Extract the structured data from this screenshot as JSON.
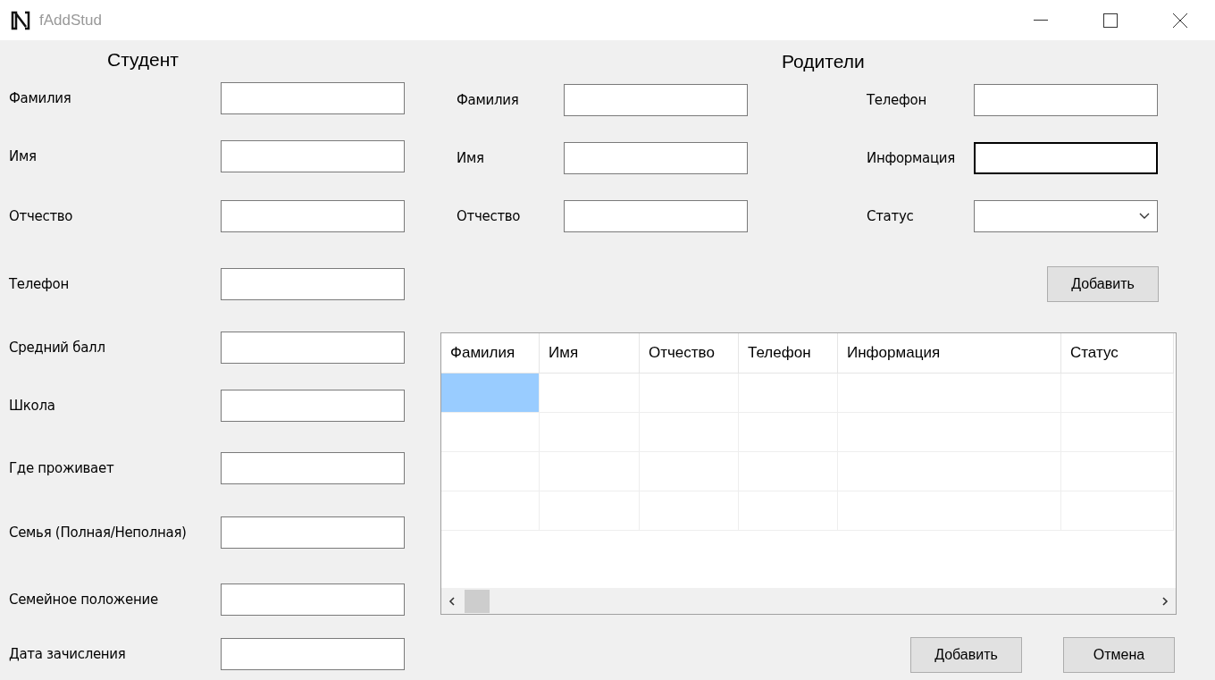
{
  "window": {
    "title": "fAddStud"
  },
  "student": {
    "heading": "Студент",
    "fields": [
      {
        "label": "Фамилия"
      },
      {
        "label": "Имя"
      },
      {
        "label": "Отчество"
      },
      {
        "label": "Телефон"
      },
      {
        "label": "Средний балл"
      },
      {
        "label": "Школа"
      },
      {
        "label": "Где проживает"
      },
      {
        "label": "Семья (Полная/Неполная)"
      },
      {
        "label": "Семейное положение"
      },
      {
        "label": "Дата зачисления"
      }
    ]
  },
  "parents": {
    "heading": "Родители",
    "fields": [
      {
        "label": "Фамилия",
        "kind": "text",
        "focused": false
      },
      {
        "label": "Телефон",
        "kind": "text",
        "focused": false
      },
      {
        "label": "Имя",
        "kind": "text",
        "focused": false
      },
      {
        "label": "Информация",
        "kind": "text",
        "focused": true
      },
      {
        "label": "Отчество",
        "kind": "text",
        "focused": false
      },
      {
        "label": "Статус",
        "kind": "dropdown",
        "focused": false
      }
    ],
    "add_button": "Добавить",
    "table": {
      "columns": [
        "Фамилия",
        "Имя",
        "Отчество",
        "Телефон",
        "Информация",
        "Статус"
      ],
      "rows": [
        {
          "cells": [
            {
              "selected": true
            },
            {
              "selected": false
            },
            {
              "selected": false
            },
            {
              "selected": false
            },
            {
              "selected": false
            },
            {
              "selected": false
            }
          ]
        },
        {
          "cells": [
            {
              "selected": false
            },
            {
              "selected": false
            },
            {
              "selected": false
            },
            {
              "selected": false
            },
            {
              "selected": false
            },
            {
              "selected": false
            }
          ]
        },
        {
          "cells": [
            {
              "selected": false
            },
            {
              "selected": false
            },
            {
              "selected": false
            },
            {
              "selected": false
            },
            {
              "selected": false
            },
            {
              "selected": false
            }
          ]
        },
        {
          "cells": [
            {
              "selected": false
            },
            {
              "selected": false
            },
            {
              "selected": false
            },
            {
              "selected": false
            },
            {
              "selected": false
            },
            {
              "selected": false
            }
          ]
        }
      ]
    }
  },
  "buttons": [
    "Добавить",
    "Отмена"
  ]
}
